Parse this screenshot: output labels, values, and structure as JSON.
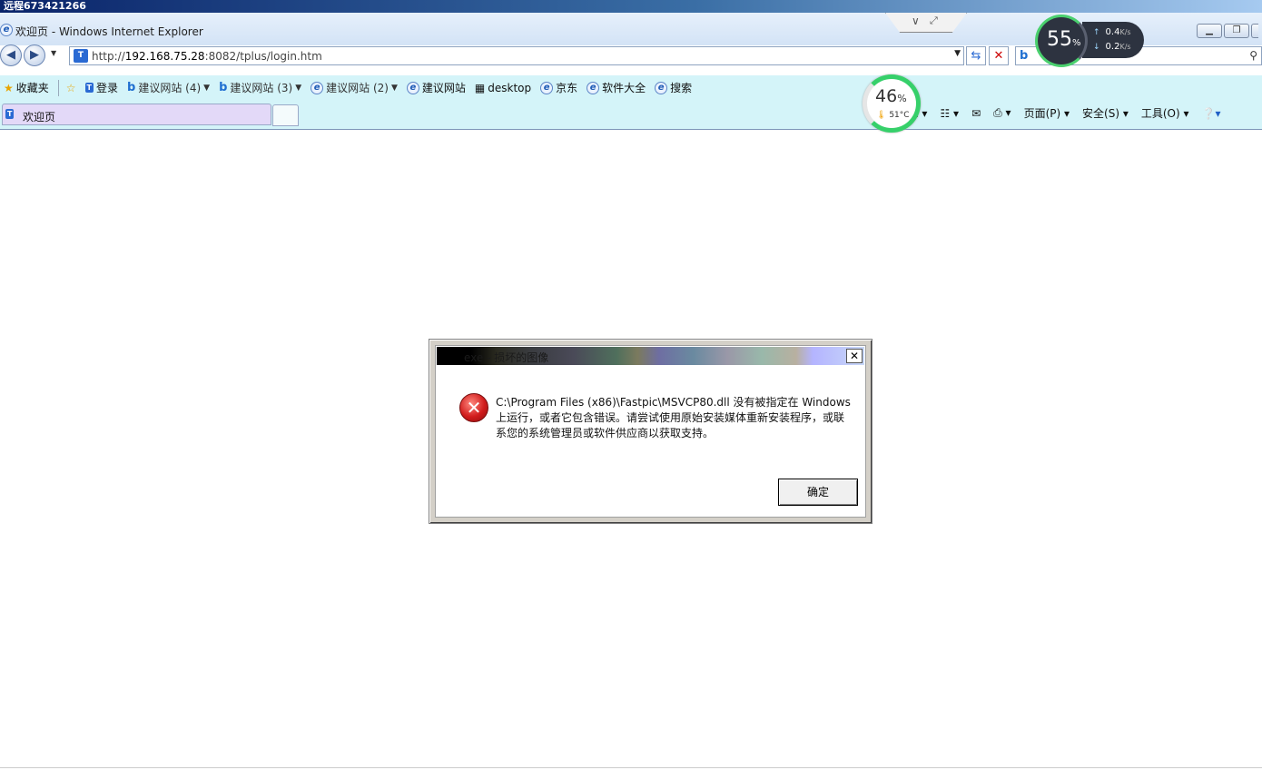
{
  "remote": {
    "title": "远程673421266"
  },
  "window": {
    "title": "欢迎页 - Windows Internet Explorer"
  },
  "address": {
    "url_prefix": "http://",
    "url_host": "192.168.75.28",
    "url_rest": ":8082/tplus/login.htm"
  },
  "favorites": {
    "label": "收藏夹",
    "items": [
      {
        "label": "登录"
      },
      {
        "label": "建议网站 (4)"
      },
      {
        "label": "建议网站 (3)"
      },
      {
        "label": "建议网站 (2)"
      },
      {
        "label": "建议网站"
      },
      {
        "label": "desktop"
      },
      {
        "label": "京东"
      },
      {
        "label": "软件大全"
      },
      {
        "label": "搜索"
      }
    ]
  },
  "tabs": {
    "active_title": "欢迎页"
  },
  "commandbar": {
    "page": "页面(P)",
    "safety": "安全(S)",
    "tools": "工具(O)"
  },
  "widgets": {
    "cpu_percent": "46",
    "cpu_unit": "%",
    "temp": "51°C",
    "mem_percent": "55",
    "mem_unit": "%",
    "upload": "0.4",
    "download": "0.2",
    "speed_unit": "K/s"
  },
  "dialog": {
    "title": "exe - 损坏的图像",
    "message": "C:\\Program Files (x86)\\Fastpic\\MSVCP80.dll 没有被指定在 Windows 上运行，或者它包含错误。请尝试使用原始安装媒体重新安装程序，或联系您的系统管理员或软件供应商以获取支持。",
    "ok_label": "确定"
  }
}
